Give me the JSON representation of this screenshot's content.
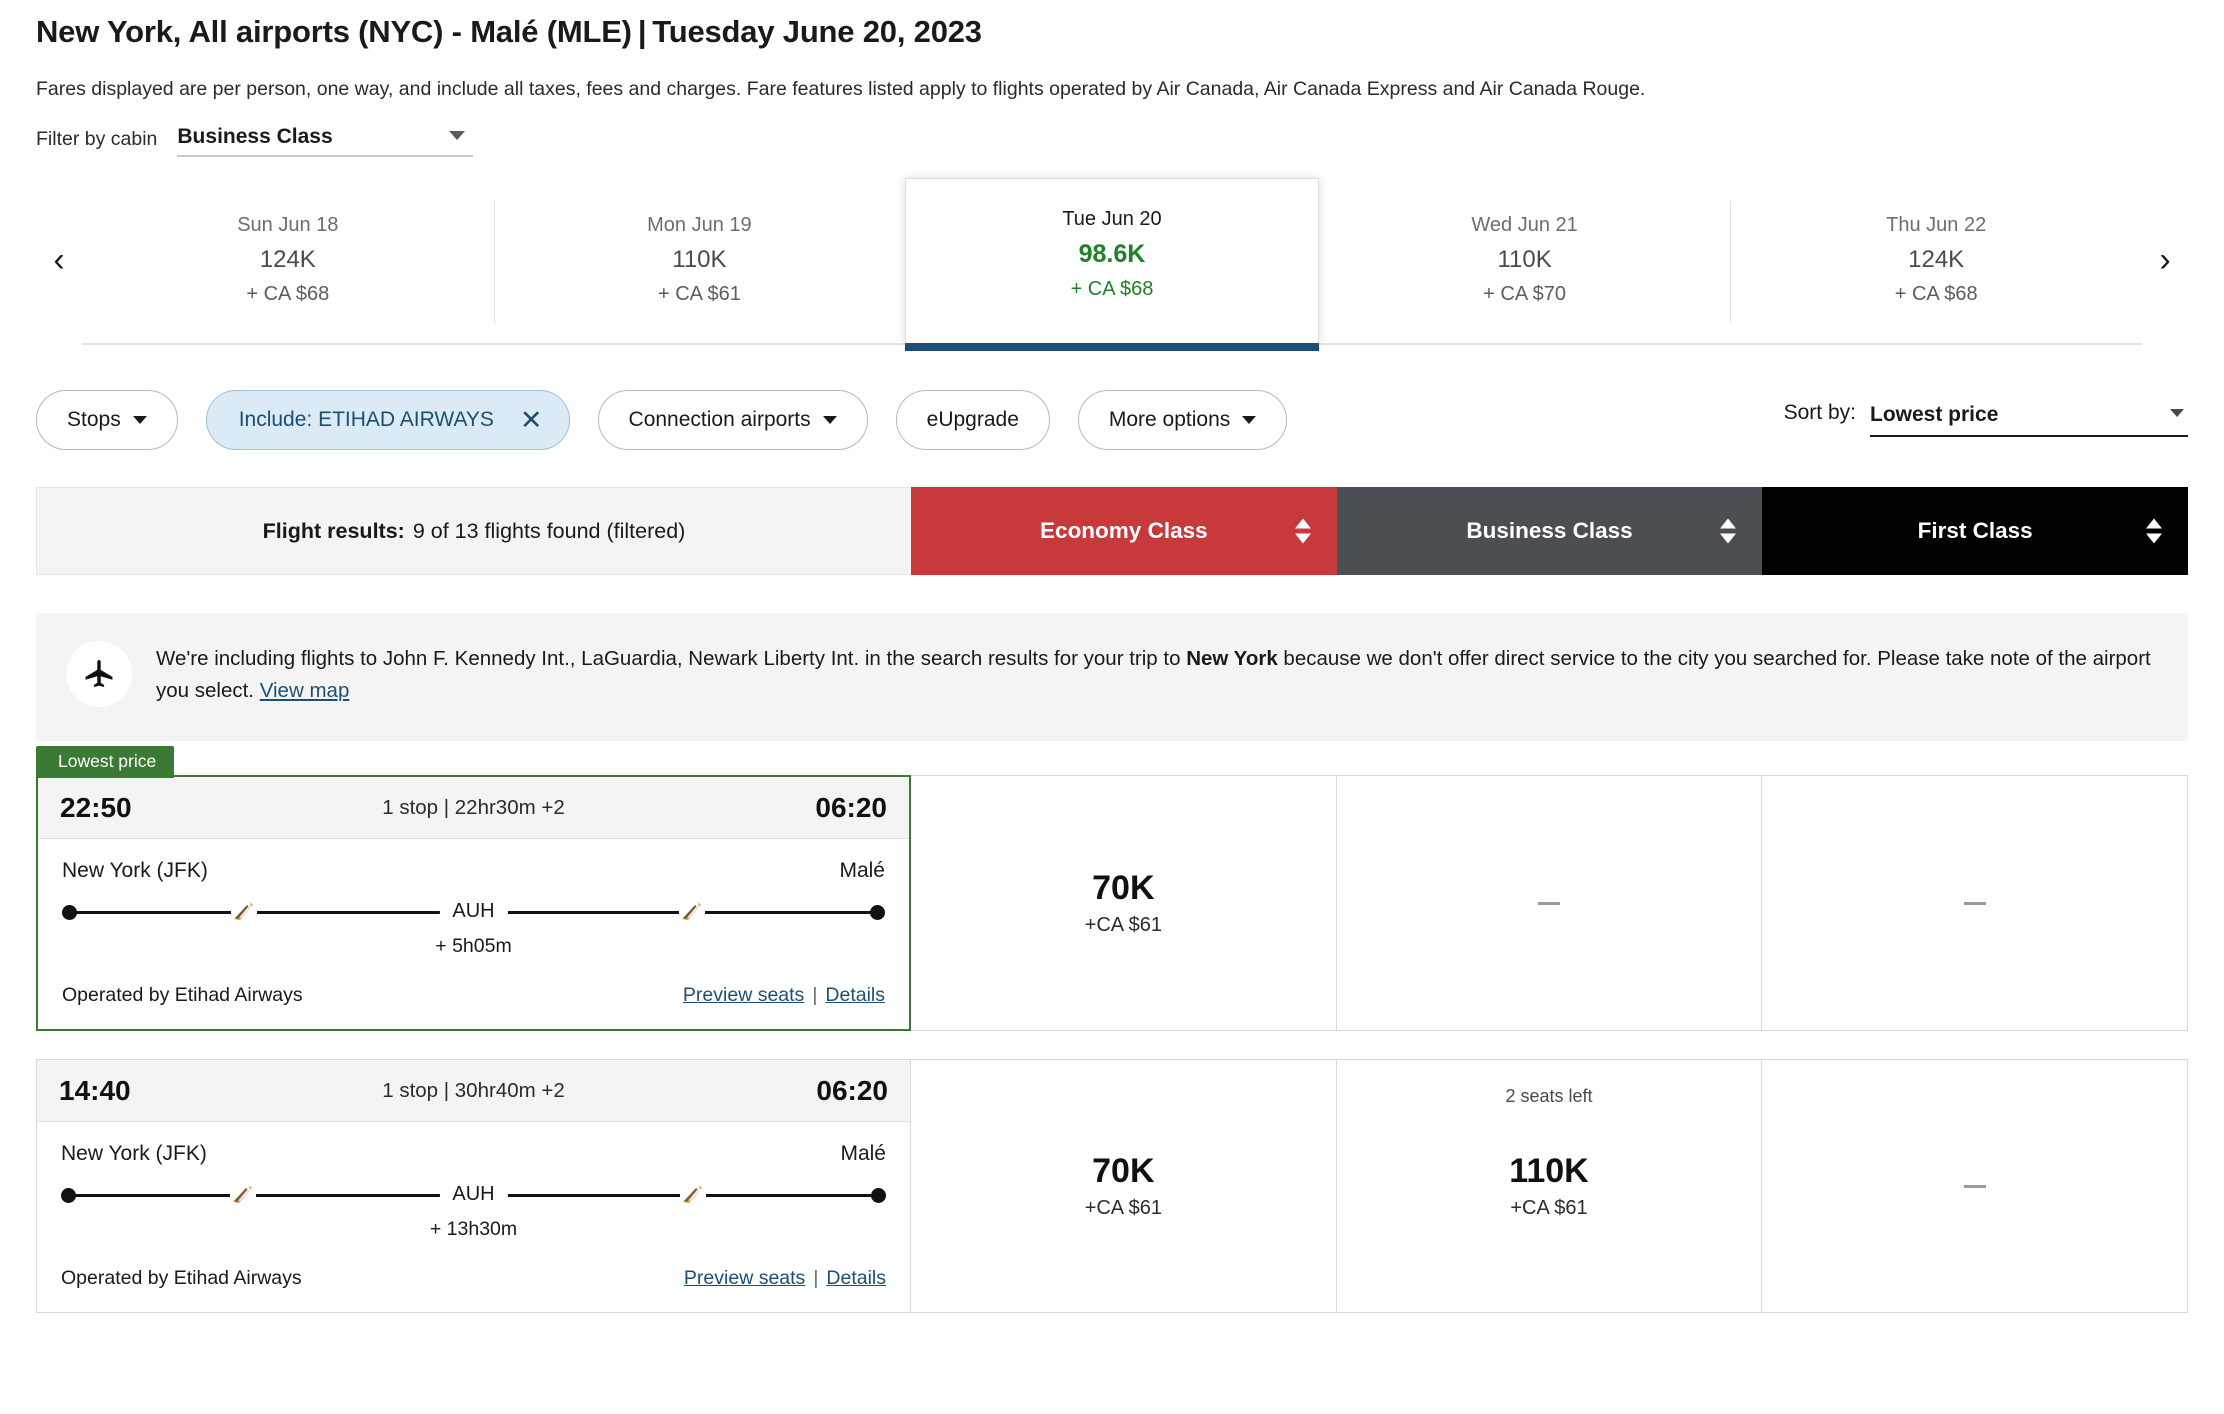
{
  "header": {
    "origin": "New York, All airports (NYC) - Malé (MLE)",
    "separator": "|",
    "date": "Tuesday June 20, 2023",
    "subtitle": "Fares displayed are per person, one way, and include all taxes, fees and charges. Fare features listed apply to flights operated by Air Canada, Air Canada Express and Air Canada Rouge."
  },
  "cabin_filter": {
    "label": "Filter by cabin",
    "value": "Business Class",
    "chevron": "chevron-down-icon"
  },
  "date_strip": {
    "prev": "‹",
    "next": "›",
    "days": [
      {
        "day": "Sun Jun 18",
        "points": "124K",
        "cash": "+ CA $68",
        "selected": false
      },
      {
        "day": "Mon Jun 19",
        "points": "110K",
        "cash": "+ CA $61",
        "selected": false
      },
      {
        "day": "Tue Jun 20",
        "points": "98.6K",
        "cash": "+ CA $68",
        "selected": true
      },
      {
        "day": "Wed Jun 21",
        "points": "110K",
        "cash": "+ CA $70",
        "selected": false
      },
      {
        "day": "Thu Jun 22",
        "points": "124K",
        "cash": "+ CA $68",
        "selected": false
      }
    ],
    "selected_accent": "#1c4f78",
    "selected_price_color": "#1f8129"
  },
  "filters": {
    "stops": "Stops",
    "include_airline": "Include: ETIHAD AIRWAYS",
    "include_close": "✕",
    "connection_airports": "Connection airports",
    "eupgrade": "eUpgrade",
    "more_options": "More options",
    "sort_label": "Sort by:",
    "sort_value": "Lowest price"
  },
  "results_header": {
    "label": "Flight results:",
    "count": "9 of 13 flights found (filtered)",
    "columns": [
      {
        "name": "Economy Class",
        "color": "#c8393c"
      },
      {
        "name": "Business Class",
        "color": "#4b4f54"
      },
      {
        "name": "First Class",
        "color": "#000000"
      }
    ]
  },
  "banner": {
    "icon": "airplane-icon",
    "text_1": "We're including flights to John F. Kennedy Int., LaGuardia, Newark Liberty Int. in the search results for your trip to ",
    "bold": "New York",
    "text_2": " because we don't offer direct service to the city you searched for. Please take note of the airport you select. ",
    "link": "View map"
  },
  "flights": [
    {
      "badge": "Lowest price",
      "depart_time": "22:50",
      "summary": "1 stop | 22hr30m +2",
      "arrive_time": "06:20",
      "origin": "New York (JFK)",
      "destination": "Malé",
      "hub": "AUH",
      "layover": "+ 5h05m",
      "operator": "Operated by Etihad Airways",
      "preview_seats": "Preview seats",
      "pipe": "|",
      "details": "Details",
      "prices": [
        {
          "seats": "",
          "points": "70K",
          "cash": "+CA $61",
          "unavailable": false
        },
        {
          "seats": "",
          "points": "",
          "cash": "",
          "unavailable": true
        },
        {
          "seats": "",
          "points": "",
          "cash": "",
          "unavailable": true
        }
      ]
    },
    {
      "badge": "",
      "depart_time": "14:40",
      "summary": "1 stop | 30hr40m +2",
      "arrive_time": "06:20",
      "origin": "New York (JFK)",
      "destination": "Malé",
      "hub": "AUH",
      "layover": "+ 13h30m",
      "operator": "Operated by Etihad Airways",
      "preview_seats": "Preview seats",
      "pipe": "|",
      "details": "Details",
      "prices": [
        {
          "seats": "",
          "points": "70K",
          "cash": "+CA $61",
          "unavailable": false
        },
        {
          "seats": "2 seats left",
          "points": "110K",
          "cash": "+CA $61",
          "unavailable": false
        },
        {
          "seats": "",
          "points": "",
          "cash": "",
          "unavailable": true
        }
      ]
    }
  ]
}
